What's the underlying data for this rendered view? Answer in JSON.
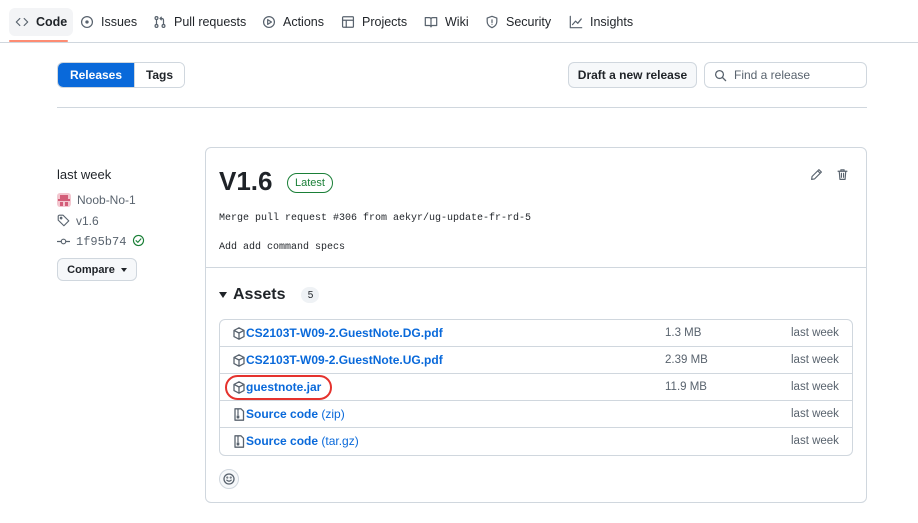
{
  "nav": {
    "tabs": [
      {
        "label": "Code",
        "icon": "code-icon",
        "selected": true
      },
      {
        "label": "Issues",
        "icon": "issue-icon"
      },
      {
        "label": "Pull requests",
        "icon": "pull-request-icon"
      },
      {
        "label": "Actions",
        "icon": "play-icon"
      },
      {
        "label": "Projects",
        "icon": "table-icon"
      },
      {
        "label": "Wiki",
        "icon": "book-icon"
      },
      {
        "label": "Security",
        "icon": "shield-icon"
      },
      {
        "label": "Insights",
        "icon": "graph-icon"
      }
    ]
  },
  "subnav": {
    "releases_label": "Releases",
    "tags_label": "Tags",
    "draft_label": "Draft a new release",
    "search_placeholder": "Find a release"
  },
  "release": {
    "when": "last week",
    "author": "Noob-No-1",
    "tag": "v1.6",
    "commit": "1f95b74",
    "compare_label": "Compare",
    "title": "V1.6",
    "badge": "Latest",
    "body": [
      "Merge pull request #306 from aekyr/ug-update-fr-rd-5",
      "Add add command specs"
    ],
    "assets_title": "Assets",
    "assets_count": "5",
    "assets": [
      {
        "name": "CS2103T-W09-2.GuestNote.DG.pdf",
        "suffix": "",
        "size": "1.3 MB",
        "date": "last week",
        "icon": "package-icon"
      },
      {
        "name": "CS2103T-W09-2.GuestNote.UG.pdf",
        "suffix": "",
        "size": "2.39 MB",
        "date": "last week",
        "icon": "package-icon"
      },
      {
        "name": "guestnote.jar",
        "suffix": "",
        "size": "11.9 MB",
        "date": "last week",
        "icon": "package-icon",
        "highlighted": true
      },
      {
        "name": "Source code",
        "suffix": "(zip)",
        "size": "",
        "date": "last week",
        "icon": "file-zip-icon"
      },
      {
        "name": "Source code",
        "suffix": "(tar.gz)",
        "size": "",
        "date": "last week",
        "icon": "file-zip-icon"
      }
    ]
  },
  "colors": {
    "accent": "#0969da",
    "success": "#1a7f37",
    "highlight_ring": "#e5322d",
    "tab_underline": "#fd8c73"
  }
}
